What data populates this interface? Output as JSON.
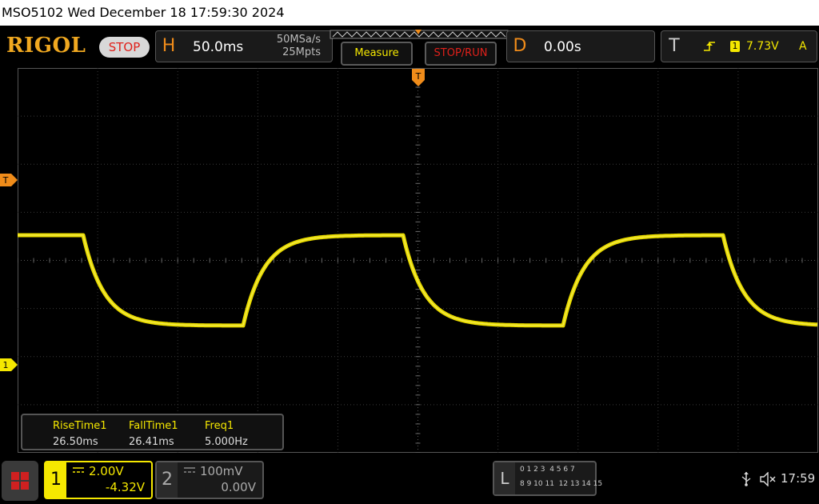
{
  "titlebar": {
    "text": "MSO5102  Wed December 18 17:59:30 2024"
  },
  "brand": {
    "logo": "RIGOL",
    "status": "STOP"
  },
  "horizontal": {
    "letter": "H",
    "timebase": "50.0ms",
    "sample_rate": "50MSa/s",
    "memory_depth": "25Mpts"
  },
  "buttons": {
    "measure": "Measure",
    "stop_run": "STOP/RUN"
  },
  "delay": {
    "letter": "D",
    "value": "0.00s"
  },
  "trigger": {
    "letter": "T",
    "channel": "1",
    "level": "7.73V",
    "mode": "A"
  },
  "markers": {
    "trigger_level": "T",
    "channel1": "1",
    "trigger_position": "T"
  },
  "measurements": [
    {
      "label": "RiseTime1",
      "value": "26.50ms"
    },
    {
      "label": "FallTime1",
      "value": "26.41ms"
    },
    {
      "label": "Freq1",
      "value": "5.000Hz"
    }
  ],
  "channel1": {
    "number": "1",
    "scale": "2.00V",
    "offset": "-4.32V",
    "color": "#f5e800"
  },
  "channel2": {
    "number": "2",
    "scale": "100mV",
    "offset": "0.00V"
  },
  "logic": {
    "letter": "L",
    "row1": "0 1 2 3  4 5 6 7",
    "row2": "8 9 10 11  12 13 14 15"
  },
  "status_bar": {
    "time": "17:59"
  },
  "colors": {
    "trace": "#f5e800",
    "accent_orange": "#f08c1a",
    "stop_red": "#e0201a",
    "grid": "#3a3a3a"
  },
  "icons": {
    "menu": "grid-menu-icon",
    "usb": "usb-icon",
    "speaker": "speaker-muted-icon",
    "edge": "rising-edge-icon"
  }
}
